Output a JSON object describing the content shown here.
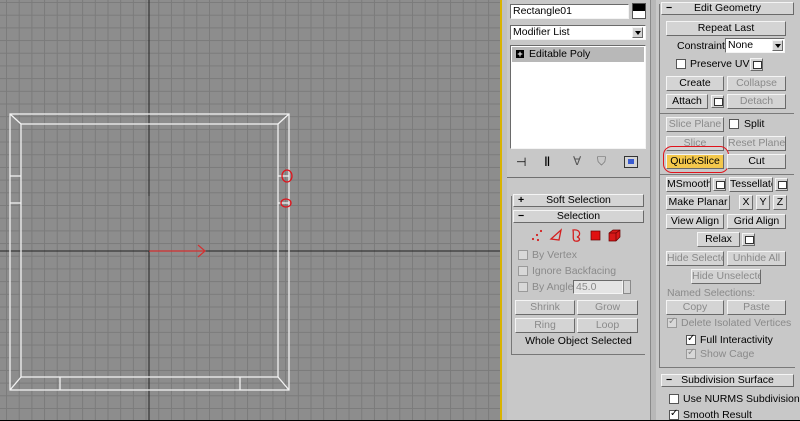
{
  "object_name": "Rectangle01",
  "object_color": "#ffffff",
  "modifier_list": {
    "value": "Modifier List"
  },
  "stack": {
    "items": [
      {
        "label": "Editable Poly",
        "expander": "+"
      }
    ]
  },
  "stack_toolbar": {
    "icons": [
      "pin-stack-icon",
      "show-end-result-icon",
      "make-unique-icon",
      "remove-modifier-icon",
      "configure-modifier-sets-icon"
    ]
  },
  "soft_selection": {
    "sign": "+",
    "title": "Soft Selection"
  },
  "selection": {
    "sign": "−",
    "title": "Selection",
    "modes": [
      "vertex-mode-icon",
      "edge-mode-icon",
      "border-mode-icon",
      "polygon-mode-icon",
      "element-mode-icon"
    ],
    "by_vertex": "By Vertex",
    "ignore_backfacing": "Ignore Backfacing",
    "by_angle": "By Angle:",
    "by_angle_value": "45.0",
    "shrink": "Shrink",
    "grow": "Grow",
    "ring": "Ring",
    "loop": "Loop",
    "status": "Whole Object Selected"
  },
  "edit_geometry": {
    "sign": "−",
    "title": "Edit Geometry",
    "repeat_last": "Repeat Last",
    "constraints_label": "Constraints:",
    "constraints_value": "None",
    "preserve_uvs": "Preserve UVs",
    "create": "Create",
    "collapse": "Collapse",
    "attach": "Attach",
    "detach": "Detach",
    "slice_plane": "Slice Plane",
    "split": "Split",
    "slice": "Slice",
    "reset_plane": "Reset Plane",
    "quickslice": "QuickSlice",
    "cut": "Cut",
    "msmooth": "MSmooth",
    "tessellate": "Tessellate",
    "make_planar": "Make Planar",
    "x": "X",
    "y": "Y",
    "z": "Z",
    "view_align": "View Align",
    "grid_align": "Grid Align",
    "relax": "Relax",
    "hide_selected": "Hide Selected",
    "unhide_all": "Unhide All",
    "hide_unselected": "Hide Unselected",
    "named_selections": "Named Selections:",
    "copy": "Copy",
    "paste": "Paste",
    "delete_isolated": "Delete Isolated Vertices",
    "full_interactivity": "Full Interactivity",
    "show_cage": "Show Cage"
  },
  "subdivision": {
    "sign": "−",
    "title": "Subdivision Surface",
    "use_nurms": "Use NURMS Subdivision",
    "smooth_result": "Smooth Result"
  },
  "colors": {
    "highlight": "#f4c84c",
    "annotation": "#e0141c",
    "viewport_bg": "#8d8d8d"
  }
}
